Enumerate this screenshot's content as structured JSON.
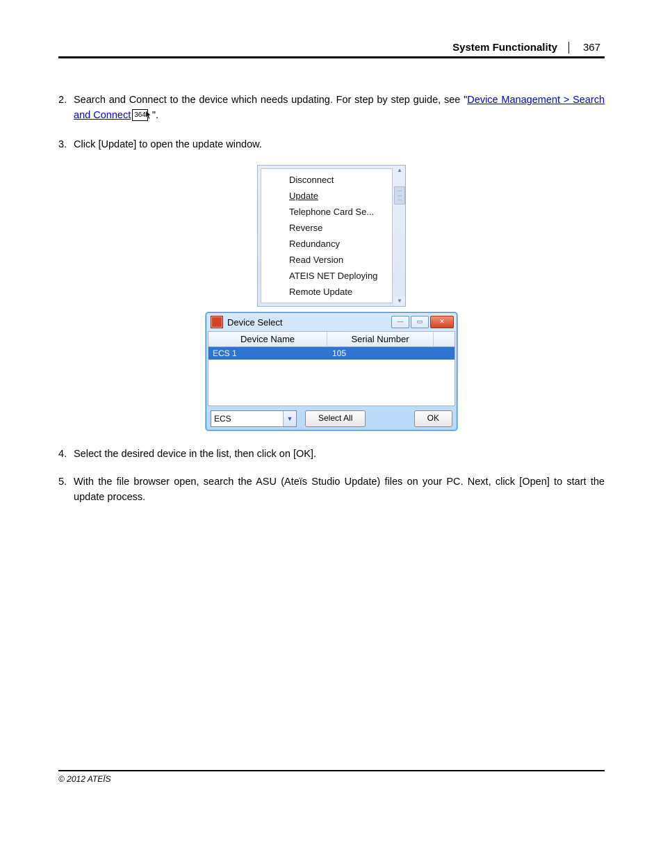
{
  "header": {
    "title": "System Functionality",
    "page": "367"
  },
  "steps": {
    "s2": {
      "num": "2.",
      "pre": "Search and Connect to the device which needs updating. For step by step guide, see \"",
      "link": "Device Management > Search and Connect",
      "ref": "364",
      "post": "\"."
    },
    "s3": {
      "num": "3.",
      "text": "Click [Update] to open the update window."
    },
    "s4": {
      "num": "4.",
      "text": "Select the desired device in the list, then click on [OK]."
    },
    "s5": {
      "num": "5.",
      "text": "With the file browser open, search the ASU (Ateïs Studio Update) files on your PC. Next, click [Open] to start the update process."
    }
  },
  "menu": {
    "items": [
      "Disconnect",
      "Update",
      "Telephone Card Se...",
      "Reverse",
      "Redundancy",
      "Read Version",
      "ATEIS NET Deploying",
      "Remote Update"
    ],
    "selected": "Update"
  },
  "dialog": {
    "title": "Device Select",
    "cols": {
      "dn": "Device Name",
      "sn": "Serial Number"
    },
    "row": {
      "dn": "ECS 1",
      "sn": "105"
    },
    "combo": "ECS",
    "selectAll": "Select All",
    "ok": "OK"
  },
  "footer": "© 2012 ATEÏS"
}
